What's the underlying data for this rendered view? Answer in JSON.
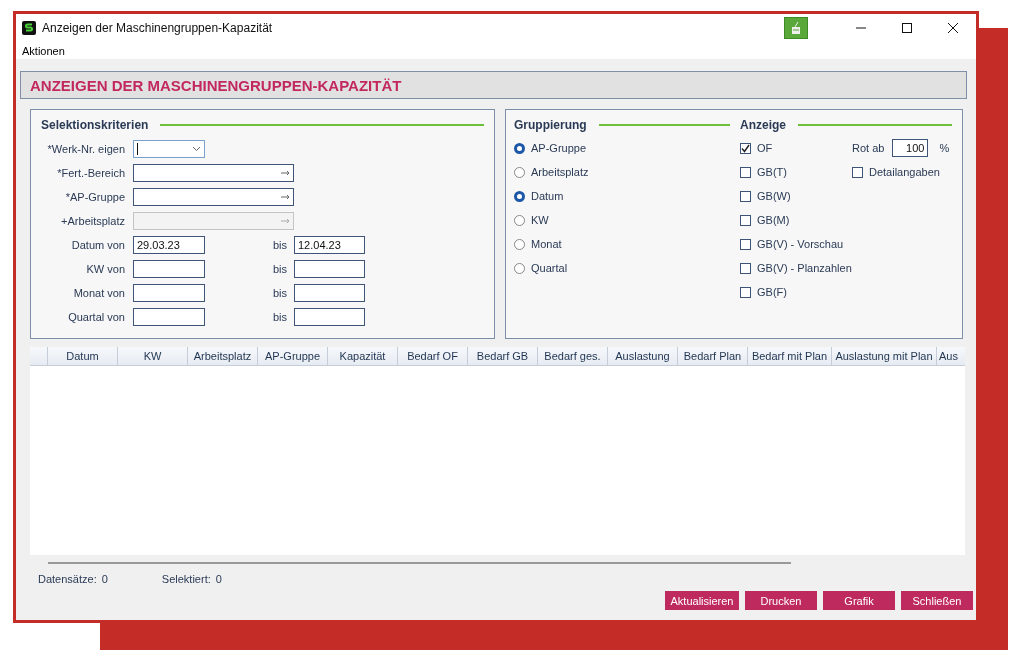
{
  "window": {
    "title": "Anzeigen der Maschinengruppen-Kapazität"
  },
  "menu": [
    "Aktionen"
  ],
  "header": "ANZEIGEN DER MASCHINENGRUPPEN-KAPAZITÄT",
  "selection": {
    "title": "Selektionskriterien",
    "fields": [
      {
        "label": "*Werk-Nr. eigen",
        "kind": "combo"
      },
      {
        "label": "*Fert.-Bereich",
        "kind": "lookup",
        "disabled": false
      },
      {
        "label": "*AP-Gruppe",
        "kind": "lookup",
        "disabled": false
      },
      {
        "label": "+Arbeitsplatz",
        "kind": "lookup",
        "disabled": true
      }
    ],
    "ranges": [
      {
        "label": "Datum von",
        "from": "29.03.23",
        "to_label": "bis",
        "to": "12.04.23"
      },
      {
        "label": "KW von",
        "to_label": "bis"
      },
      {
        "label": "Monat von",
        "to_label": "bis"
      },
      {
        "label": "Quartal von",
        "to_label": "bis"
      }
    ]
  },
  "grouping": {
    "title": "Gruppierung",
    "options": [
      {
        "label": "AP-Gruppe",
        "selected": true
      },
      {
        "label": "Arbeitsplatz",
        "selected": false
      },
      {
        "label": "Datum",
        "selected": true
      },
      {
        "label": "KW",
        "selected": false
      },
      {
        "label": "Monat",
        "selected": false
      },
      {
        "label": "Quartal",
        "selected": false
      }
    ]
  },
  "display": {
    "title": "Anzeige",
    "options": [
      {
        "label": "OF",
        "checked": true
      },
      {
        "label": "GB(T)",
        "checked": false
      },
      {
        "label": "GB(W)",
        "checked": false
      },
      {
        "label": "GB(M)",
        "checked": false
      },
      {
        "label": "GB(V) - Vorschau",
        "checked": false
      },
      {
        "label": "GB(V) - Planzahlen",
        "checked": false
      },
      {
        "label": "GB(F)",
        "checked": false
      }
    ],
    "red_from": {
      "label": "Rot ab",
      "value": "100",
      "unit": "%"
    },
    "details": {
      "label": "Detailangaben",
      "checked": false
    }
  },
  "table": {
    "columns": [
      "Datum",
      "KW",
      "Arbeitsplatz",
      "AP-Gruppe",
      "Kapazität",
      "Bedarf OF",
      "Bedarf GB",
      "Bedarf ges.",
      "Auslastung",
      "Bedarf Plan",
      "Bedarf mit Plan",
      "Auslastung mit Plan",
      "Aus"
    ]
  },
  "status": [
    {
      "label": "Datensätze:",
      "value": "0"
    },
    {
      "label": "Selektiert:",
      "value": "0"
    }
  ],
  "buttons": [
    "Aktualisieren",
    "Drucken",
    "Grafik",
    "Schließen"
  ]
}
